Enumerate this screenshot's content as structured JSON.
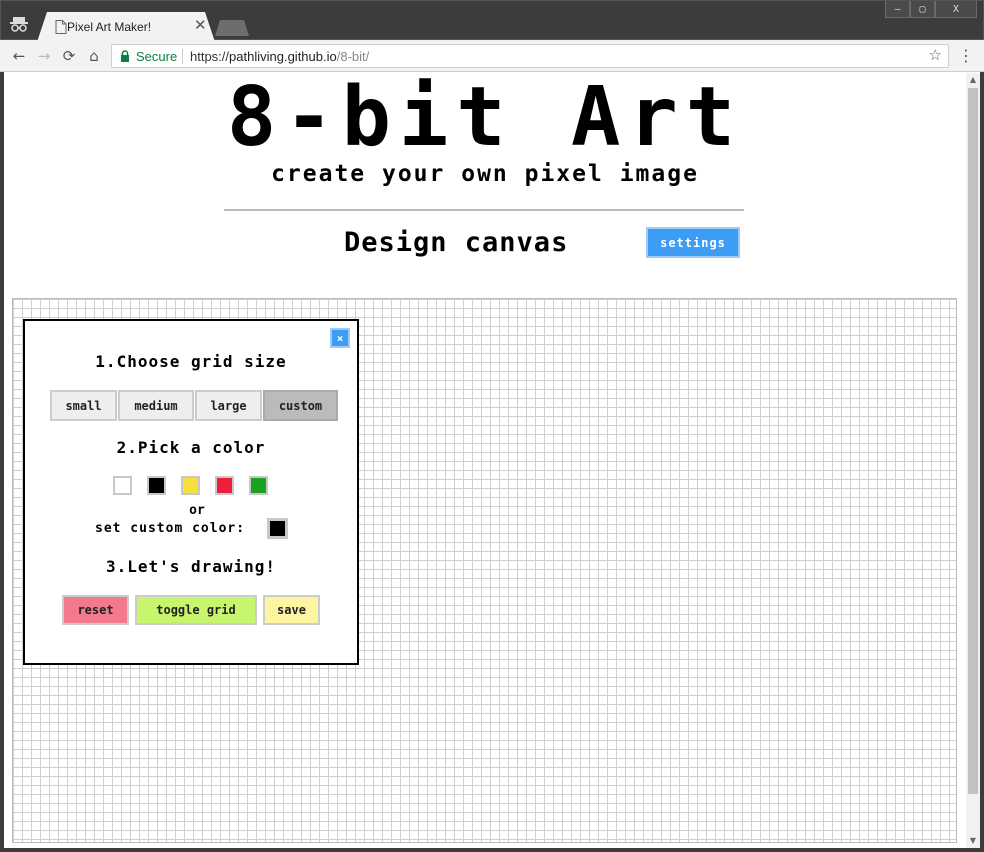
{
  "browser": {
    "tab_title": "Pixel Art Maker!",
    "tab_close": "✕",
    "nav": {
      "back": "←",
      "forward": "→",
      "reload": "⟳",
      "home": "⌂"
    },
    "secure_label": "Secure",
    "url_scheme": "https://",
    "url_host": "pathliving.github.io",
    "url_path": "/8-bit/",
    "star": "☆",
    "menu": "⋮",
    "window_controls": {
      "minimize": "—",
      "maximize": "▢",
      "close": "X"
    }
  },
  "page": {
    "title": "8-bit Art",
    "subtitle": "create your own pixel image",
    "canvas_heading": "Design canvas",
    "settings_label": "settings"
  },
  "modal": {
    "close_label": "×",
    "step1": "1.Choose grid size",
    "sizes": [
      "small",
      "medium",
      "large",
      "custom"
    ],
    "active_size": "custom",
    "step2": "2.Pick a color",
    "colors": [
      "#ffffff",
      "#000000",
      "#f5e03b",
      "#ee1f3a",
      "#1aa323"
    ],
    "or_text": "or",
    "custom_color_label": "set custom color:",
    "custom_color": "#000000",
    "step3": "3.Let's drawing!",
    "actions": [
      {
        "label": "reset",
        "color": "#f37a8c"
      },
      {
        "label": "toggle grid",
        "color": "#c8f56e"
      },
      {
        "label": "save",
        "color": "#fdf5a0"
      }
    ]
  },
  "colors": {
    "accent": "#3d9df5",
    "grid_line": "#cfcfcf"
  }
}
